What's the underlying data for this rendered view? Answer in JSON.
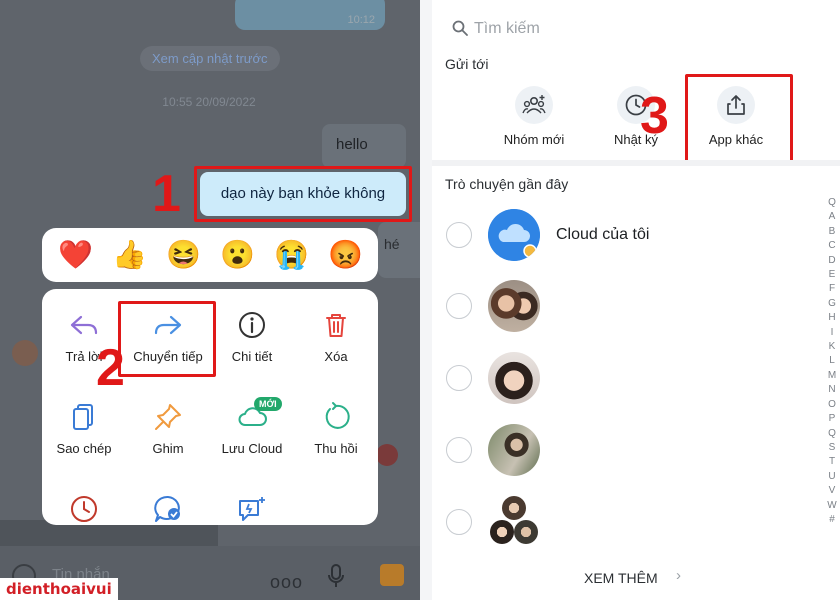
{
  "chat": {
    "top_time": "10:12",
    "load_previous": "Xem cập nhật trước",
    "date_divider": "10:55 20/09/2022",
    "msg_hello": "hello",
    "msg_selected": "dạo này bạn khỏe không",
    "msg_partial": "hé",
    "input_placeholder": "Tin nhắn",
    "more_dots": "ooo"
  },
  "reactions": [
    {
      "icon": "red-heart",
      "glyph": "❤️"
    },
    {
      "icon": "thumbs-up",
      "glyph": "👍"
    },
    {
      "icon": "laughing-face",
      "glyph": "😆"
    },
    {
      "icon": "surprised-face",
      "glyph": "😮"
    },
    {
      "icon": "crying-face",
      "glyph": "😭"
    },
    {
      "icon": "angry-face",
      "glyph": "😡"
    }
  ],
  "context_menu": {
    "reply": "Trả lời",
    "forward": "Chuyển tiếp",
    "details": "Chi tiết",
    "delete": "Xóa",
    "copy": "Sao chép",
    "pin": "Ghim",
    "save_cloud": "Lưu Cloud",
    "save_cloud_badge": "MỚI",
    "recall": "Thu hồi"
  },
  "steps": {
    "one": "1",
    "two": "2",
    "three": "3"
  },
  "share_sheet": {
    "search_placeholder": "Tìm kiếm",
    "send_to": "Gửi tới",
    "new_group": "Nhóm mới",
    "diary": "Nhật ký",
    "other_apps": "App khác",
    "recent_chats": "Trò chuyện gần đây",
    "cloud_name": "Cloud của tôi",
    "see_more": "XEM THÊM",
    "alphabet": [
      "Q",
      "A",
      "B",
      "C",
      "D",
      "E",
      "F",
      "G",
      "H",
      "I",
      "K",
      "L",
      "M",
      "N",
      "O",
      "P",
      "Q",
      "S",
      "T",
      "U",
      "V",
      "W",
      "#"
    ]
  },
  "watermark": "dienthoaivui",
  "colors": {
    "highlight_red": "#e01818",
    "accent_blue": "#0a68fe",
    "selected_bubble": "#cdebfa"
  }
}
